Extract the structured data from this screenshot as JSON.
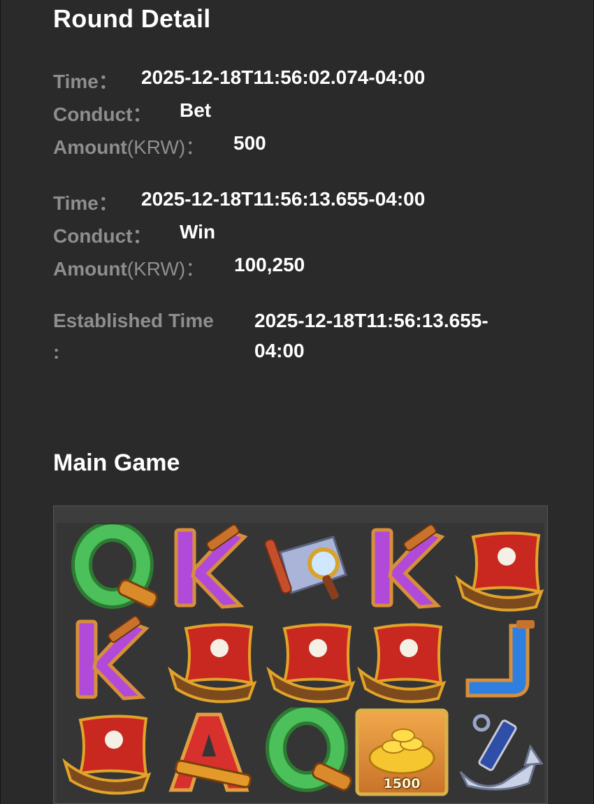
{
  "round_detail": {
    "title": "Round Detail",
    "entries": [
      {
        "time_label": "Time：",
        "time_value": "2025-12-18T11:56:02.074-04:00",
        "conduct_label": "Conduct：",
        "conduct_value": "Bet",
        "amount_label": "Amount",
        "amount_unit": "(KRW)：",
        "amount_value": "500"
      },
      {
        "time_label": "Time：",
        "time_value": "2025-12-18T11:56:13.655-04:00",
        "conduct_label": "Conduct：",
        "conduct_value": "Win",
        "amount_label": "Amount",
        "amount_unit": "(KRW)：",
        "amount_value": "100,250"
      }
    ],
    "established_label_line1": "Established Time",
    "established_label_line2": ":",
    "established_value_line1": "2025-12-18T11:56:13.655-",
    "established_value_line2": "04:00"
  },
  "main_game": {
    "title": "Main Game",
    "reels": [
      [
        "Q",
        "K",
        "scroll",
        "K",
        "ship"
      ],
      [
        "K",
        "ship",
        "ship",
        "ship",
        "J"
      ],
      [
        "ship",
        "A",
        "Q",
        "coins",
        "anchor"
      ]
    ],
    "coin_value": "1500",
    "colors": {
      "Q": "#3fa64a",
      "K": "#b14ad8",
      "J": "#2f7fe0",
      "A": "#d8302c",
      "ship_sail": "#c8281f",
      "gold": "#e7a823"
    }
  }
}
